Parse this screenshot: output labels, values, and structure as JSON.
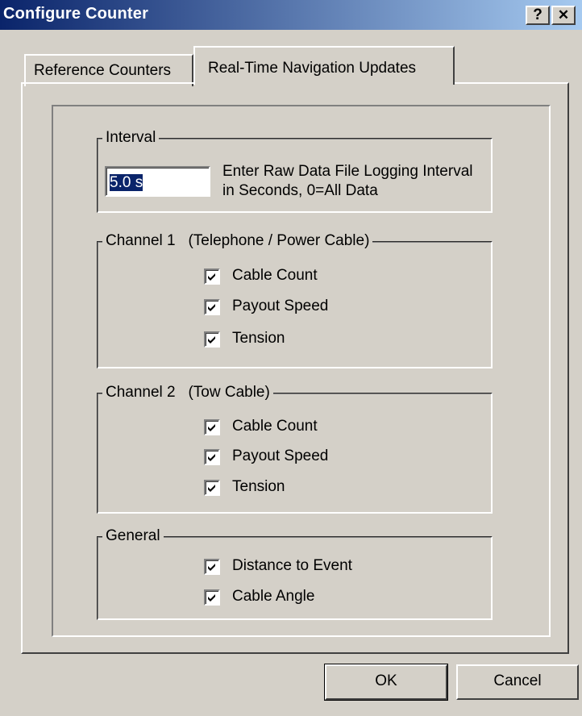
{
  "window": {
    "title": "Configure Counter",
    "help_label": "?",
    "close_label": "✕"
  },
  "tabs": [
    {
      "label": "Reference Counters",
      "active": false
    },
    {
      "label": "Real-Time Navigation Updates",
      "active": true
    }
  ],
  "interval": {
    "legend": "Interval",
    "value": "5.0 s",
    "help_text": "Enter Raw Data File Logging Interval in Seconds, 0=All Data"
  },
  "channel1": {
    "legend": "Channel 1   (Telephone / Power Cable)",
    "items": [
      {
        "label": "Cable Count",
        "checked": true
      },
      {
        "label": "Payout Speed",
        "checked": true
      },
      {
        "label": "Tension",
        "checked": true
      }
    ]
  },
  "channel2": {
    "legend": "Channel 2   (Tow Cable)",
    "items": [
      {
        "label": "Cable Count",
        "checked": true
      },
      {
        "label": "Payout Speed",
        "checked": true
      },
      {
        "label": "Tension",
        "checked": true
      }
    ]
  },
  "general": {
    "legend": "General",
    "items": [
      {
        "label": "Distance to Event",
        "checked": true
      },
      {
        "label": "Cable Angle",
        "checked": true
      }
    ]
  },
  "buttons": {
    "ok": "OK",
    "cancel": "Cancel"
  },
  "colors": {
    "title_bar_start": "#0a246a",
    "title_bar_end": "#a6caf0",
    "face": "#d4d0c8",
    "selection": "#0a246a"
  }
}
